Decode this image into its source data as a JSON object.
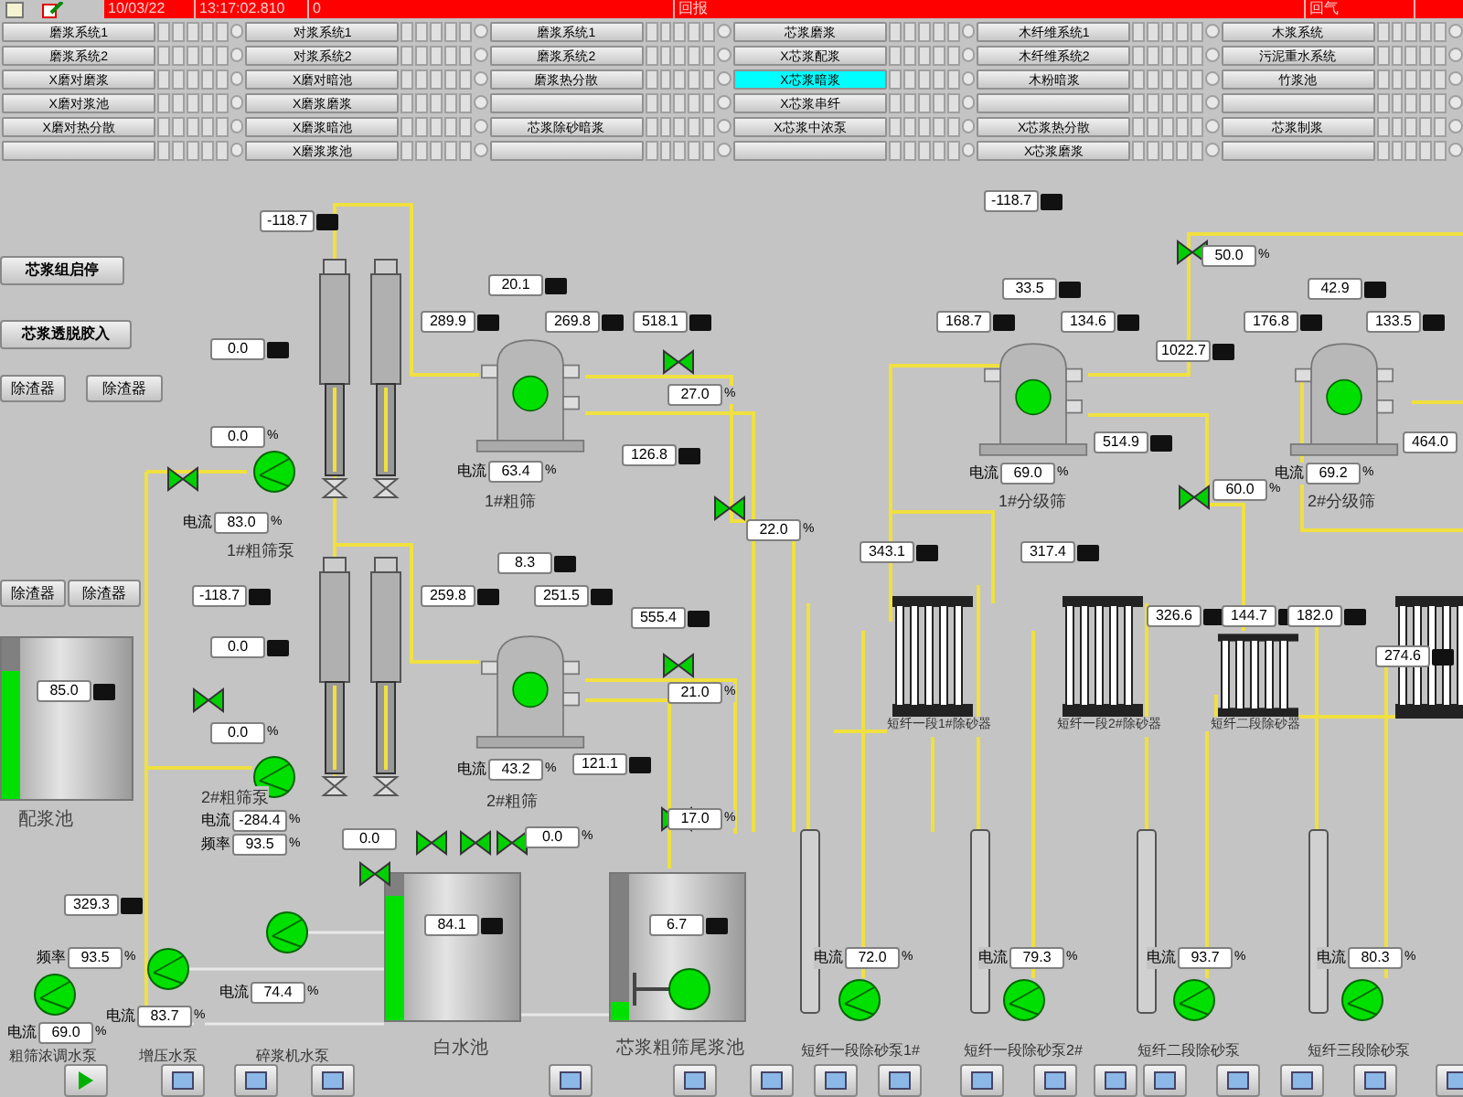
{
  "header": {
    "date": "10/03/22",
    "time": "13:17:02.810",
    "code": "0",
    "message": "回报",
    "message_2": "回气"
  },
  "button_groups": [
    {
      "buttons": [
        {
          "label": "磨浆系统1",
          "selected": false
        },
        {
          "label": "磨浆系统2",
          "selected": false
        },
        {
          "label": "X磨对磨浆",
          "selected": false
        },
        {
          "label": "X磨对浆池",
          "selected": false
        },
        {
          "label": "X磨对热分散",
          "selected": false
        },
        {
          "selected": false
        }
      ]
    },
    {
      "buttons": [
        {
          "label": "对浆系统1",
          "selected": false
        },
        {
          "label": "对浆系统2",
          "selected": false
        },
        {
          "label": "X磨对暗池",
          "selected": false
        },
        {
          "label": "X磨浆磨浆",
          "selected": false
        },
        {
          "label": "X磨浆暗池",
          "selected": false
        },
        {
          "label": "X磨浆浆池",
          "selected": false
        }
      ]
    },
    {
      "buttons": [
        {
          "label": "磨浆系统1",
          "selected": false
        },
        {
          "label": "磨浆系统2",
          "selected": false
        },
        {
          "label": "磨浆热分散",
          "selected": false
        },
        {
          "selected": false
        },
        {
          "label": "芯浆除砂暗浆",
          "selected": false
        },
        {
          "selected": false
        }
      ]
    },
    {
      "buttons": [
        {
          "label": "芯浆磨浆",
          "selected": false
        },
        {
          "label": "X芯浆配浆",
          "selected": false
        },
        {
          "label": "X芯浆暗浆",
          "selected": true
        },
        {
          "label": "X芯浆串纤",
          "selected": false
        },
        {
          "label": "X芯浆中浓泵",
          "selected": false
        },
        {
          "selected": false
        }
      ]
    },
    {
      "buttons": [
        {
          "label": "木纤维系统1",
          "selected": false
        },
        {
          "label": "木纤维系统2",
          "selected": false
        },
        {
          "label": "木粉暗浆",
          "selected": false
        },
        {
          "selected": false
        },
        {
          "label": "X芯浆热分散",
          "selected": false
        },
        {
          "label": "X芯浆磨浆",
          "selected": false
        }
      ]
    },
    {
      "buttons": [
        {
          "label": "木浆系统",
          "selected": false
        },
        {
          "label": "污泥重水系统",
          "selected": false
        },
        {
          "label": "竹浆池",
          "selected": false
        },
        {
          "selected": false
        },
        {
          "label": "芯浆制浆",
          "selected": false
        },
        {
          "selected": false
        }
      ]
    }
  ],
  "left_buttons": [
    "芯浆组启停",
    "芯浆透脱胶入",
    "除渣器",
    "除渣器",
    "除渣器",
    "除渣器"
  ],
  "tanks": [
    {
      "label": "配浆池",
      "level": 0.8
    },
    {
      "label": "白水池",
      "level": 0.85
    },
    {
      "label": "芯浆粗筛尾浆池",
      "level": 0.12
    }
  ],
  "labels": [
    "1#粗筛",
    "1#粗筛泵",
    "2#粗筛泵",
    "2#粗筛",
    "粗筛浓调水泵",
    "增压水泵",
    "碎浆机水泵",
    "1#分级筛",
    "2#分级筛",
    "短纤一段1#除砂器",
    "短纤一段2#除砂器",
    "短纤二段除砂器",
    "短纤一段除砂泵1#",
    "短纤一段除砂泵2#",
    "短纤二段除砂泵",
    "短纤三段除砂泵"
  ],
  "readouts": [
    {
      "kind": "tagged",
      "value": "-118.7"
    },
    {
      "kind": "tagged",
      "value": "0.0"
    },
    {
      "kind": "unit",
      "value": "0.0",
      "unit": "%"
    },
    {
      "kind": "current",
      "label": "电流",
      "value": "83.0",
      "unit": "%"
    },
    {
      "kind": "tagged",
      "value": "20.1"
    },
    {
      "kind": "tagged",
      "value": "289.9"
    },
    {
      "kind": "tagged",
      "value": "269.8"
    },
    {
      "kind": "tagged",
      "value": "518.1"
    },
    {
      "kind": "unit",
      "value": "27.0",
      "unit": "%"
    },
    {
      "kind": "current",
      "label": "电流",
      "value": "63.4",
      "unit": "%"
    },
    {
      "kind": "tagged",
      "value": "126.8"
    },
    {
      "kind": "unit",
      "value": "22.0",
      "unit": "%"
    },
    {
      "kind": "tagged",
      "value": "-118.7"
    },
    {
      "kind": "tagged",
      "value": "8.3"
    },
    {
      "kind": "tagged",
      "value": "259.8"
    },
    {
      "kind": "tagged",
      "value": "251.5"
    },
    {
      "kind": "tagged",
      "value": "555.4"
    },
    {
      "kind": "tagged",
      "value": "0.0"
    },
    {
      "kind": "unit",
      "value": "0.0",
      "unit": "%"
    },
    {
      "kind": "tagged",
      "value": "85.0"
    },
    {
      "kind": "unit",
      "value": "21.0",
      "unit": "%"
    },
    {
      "kind": "current",
      "label": "电流",
      "value": "43.2",
      "unit": "%"
    },
    {
      "kind": "tagged",
      "value": "121.1"
    },
    {
      "kind": "unit",
      "value": "17.0",
      "unit": "%"
    },
    {
      "kind": "current",
      "label": "电流",
      "value": "-284.4",
      "unit": "%"
    },
    {
      "kind": "current",
      "label": "频率",
      "value": "93.5",
      "unit": "%"
    },
    {
      "kind": "plain",
      "value": "0.0"
    },
    {
      "kind": "unit",
      "value": "0.0",
      "unit": "%"
    },
    {
      "kind": "tagged",
      "value": "84.1"
    },
    {
      "kind": "tagged",
      "value": "6.7"
    },
    {
      "kind": "tagged",
      "value": "329.3"
    },
    {
      "kind": "current",
      "label": "频率",
      "value": "93.5",
      "unit": "%"
    },
    {
      "kind": "current",
      "label": "电流",
      "value": "74.4",
      "unit": "%"
    },
    {
      "kind": "current",
      "label": "电流",
      "value": "83.7",
      "unit": "%"
    },
    {
      "kind": "current",
      "label": "电流",
      "value": "69.0",
      "unit": "%"
    },
    {
      "kind": "tagged",
      "value": "-118.7"
    },
    {
      "kind": "unit",
      "value": "50.0",
      "unit": "%"
    },
    {
      "kind": "tagged",
      "value": "33.5"
    },
    {
      "kind": "tagged",
      "value": "168.7"
    },
    {
      "kind": "tagged",
      "value": "134.6"
    },
    {
      "kind": "tagged",
      "value": "1022.7"
    },
    {
      "kind": "current",
      "label": "电流",
      "value": "69.0",
      "unit": "%"
    },
    {
      "kind": "tagged",
      "value": "514.9"
    },
    {
      "kind": "unit",
      "value": "60.0",
      "unit": "%"
    },
    {
      "kind": "tagged",
      "value": "42.9"
    },
    {
      "kind": "tagged",
      "value": "176.8"
    },
    {
      "kind": "tagged",
      "value": "133.5"
    },
    {
      "kind": "current",
      "label": "电流",
      "value": "69.2",
      "unit": "%"
    },
    {
      "kind": "plain",
      "value": "464.0"
    },
    {
      "kind": "tagged",
      "value": "343.1"
    },
    {
      "kind": "tagged",
      "value": "317.4"
    },
    {
      "kind": "tagged",
      "value": "326.6"
    },
    {
      "kind": "tagged",
      "value": "144.7"
    },
    {
      "kind": "tagged",
      "value": "182.0"
    },
    {
      "kind": "tagged",
      "value": "274.6"
    },
    {
      "kind": "current",
      "label": "电流",
      "value": "72.0",
      "unit": "%"
    },
    {
      "kind": "current",
      "label": "电流",
      "value": "79.3",
      "unit": "%"
    },
    {
      "kind": "current",
      "label": "电流",
      "value": "93.7",
      "unit": "%"
    },
    {
      "kind": "current",
      "label": "电流",
      "value": "80.3",
      "unit": "%"
    }
  ]
}
